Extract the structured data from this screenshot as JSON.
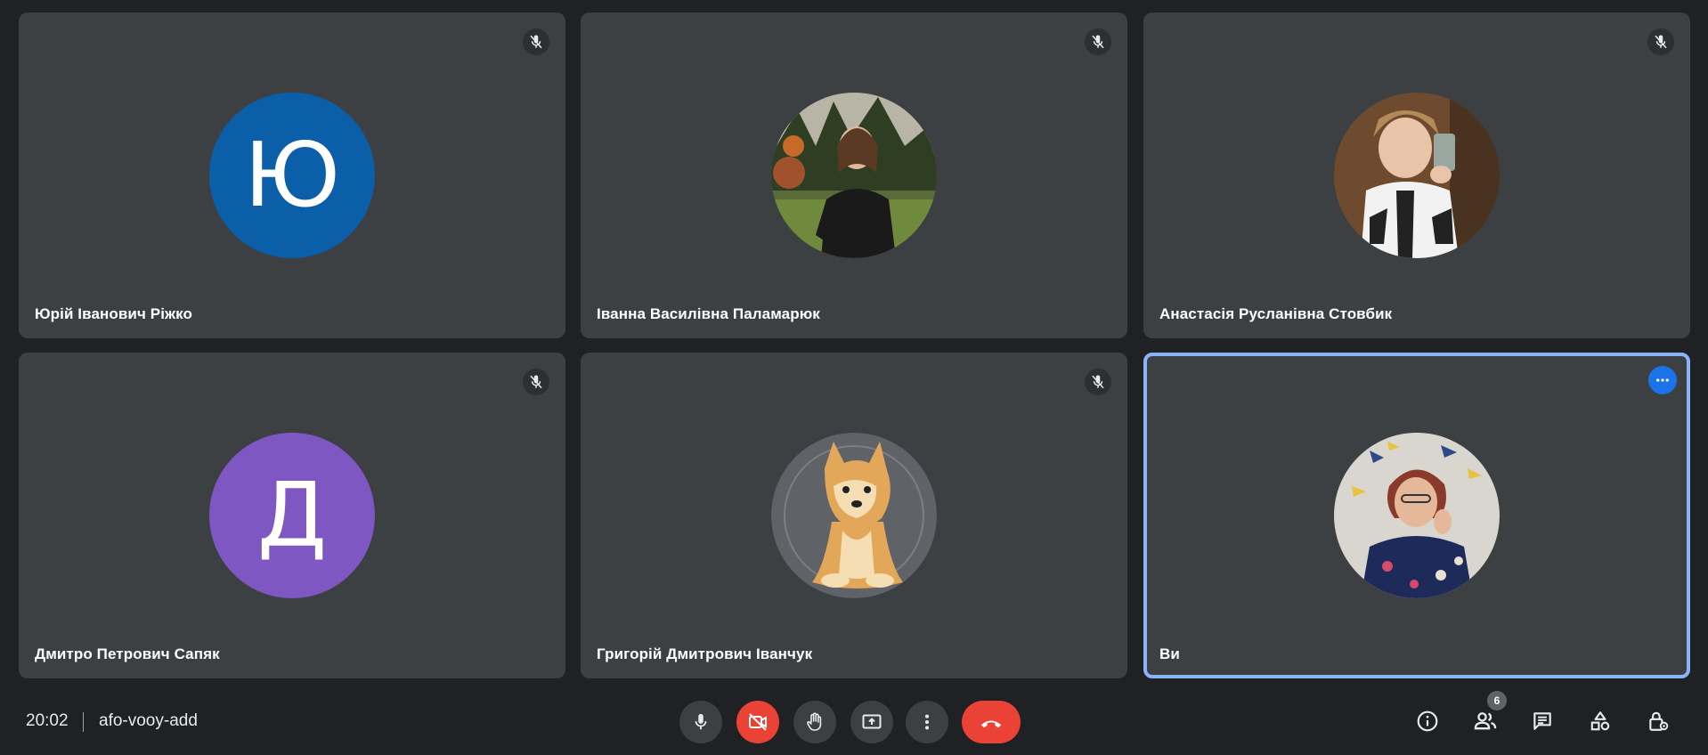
{
  "meeting": {
    "time": "20:02",
    "code": "afo-vooy-add",
    "participant_count": "6"
  },
  "participants": [
    {
      "name": "Юрій Іванович Ріжко",
      "avatar_letter": "Ю",
      "avatar_color": "#0b5ea8",
      "muted": true
    },
    {
      "name": "Іванна Василівна Паламарюк",
      "avatar_type": "photo",
      "muted": true
    },
    {
      "name": "Анастасія Русланівна Стовбик",
      "avatar_type": "photo",
      "muted": true
    },
    {
      "name": "Дмитро Петрович Сапяк",
      "avatar_letter": "Д",
      "avatar_color": "#7e57c2",
      "muted": true
    },
    {
      "name": "Григорій Дмитрович Іванчук",
      "avatar_type": "photo",
      "muted": true
    },
    {
      "name": "Ви",
      "avatar_type": "photo",
      "self": true
    }
  ],
  "controls": {
    "mic": "mic-icon",
    "camera": "camera-off-icon",
    "raise_hand": "hand-icon",
    "present": "present-screen-icon",
    "more": "more-vert-icon",
    "leave": "hang-up-icon"
  },
  "side_controls": [
    "info-icon",
    "people-icon",
    "chat-icon",
    "activities-icon",
    "host-controls-icon"
  ],
  "colors": {
    "background": "#202124",
    "tile": "#3c4043",
    "accent": "#8ab4f8",
    "danger": "#ea4335"
  }
}
